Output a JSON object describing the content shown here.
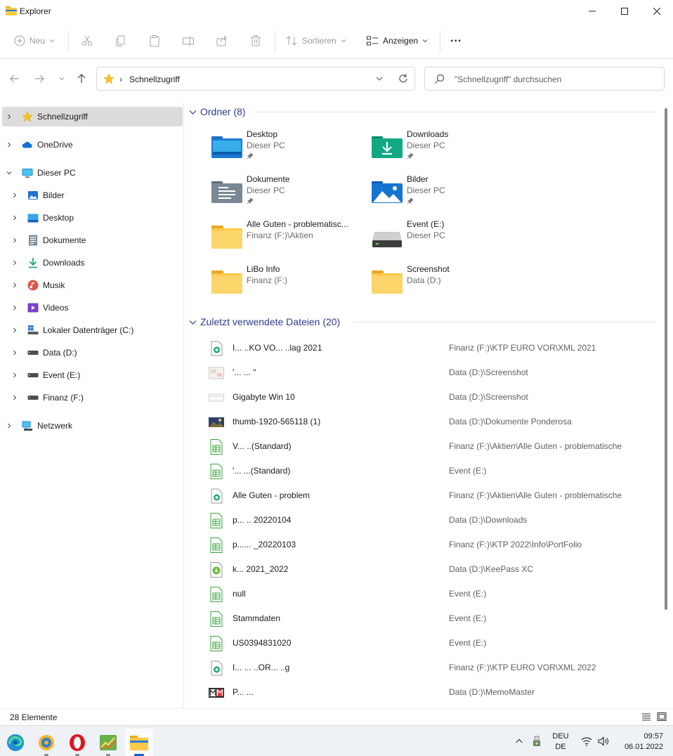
{
  "window": {
    "title": "Explorer"
  },
  "toolbar": {
    "new_label": "Neu",
    "sort_label": "Sortieren",
    "view_label": "Anzeigen",
    "more_label": "..."
  },
  "address": {
    "crumb": "Schnellzugriff"
  },
  "search": {
    "placeholder": "\"Schnellzugriff\" durchsuchen"
  },
  "sidebar": {
    "items": [
      {
        "label": "Schnellzugriff",
        "icon": "star-icon"
      },
      {
        "label": "OneDrive",
        "icon": "cloud-icon"
      },
      {
        "label": "Dieser PC",
        "icon": "monitor-icon"
      },
      {
        "label": "Bilder",
        "icon": "pictures-icon"
      },
      {
        "label": "Desktop",
        "icon": "desktop-icon"
      },
      {
        "label": "Dokumente",
        "icon": "documents-icon"
      },
      {
        "label": "Downloads",
        "icon": "download-icon"
      },
      {
        "label": "Musik",
        "icon": "music-icon"
      },
      {
        "label": "Videos",
        "icon": "videos-icon"
      },
      {
        "label": "Lokaler Datenträger (C:)",
        "icon": "windows-drive-icon"
      },
      {
        "label": "Data (D:)",
        "icon": "drive-icon"
      },
      {
        "label": "Event (E:)",
        "icon": "drive-icon"
      },
      {
        "label": "Finanz (F:)",
        "icon": "drive-icon"
      },
      {
        "label": "Netzwerk",
        "icon": "network-icon"
      }
    ]
  },
  "folders": {
    "heading": "Ordner (8)",
    "items": [
      {
        "name": "Desktop",
        "sub": "Dieser PC",
        "pinned": true,
        "icon": "desktop-folder-icon"
      },
      {
        "name": "Downloads",
        "sub": "Dieser PC",
        "pinned": true,
        "icon": "downloads-folder-icon"
      },
      {
        "name": "Dokumente",
        "sub": "Dieser PC",
        "pinned": true,
        "icon": "documents-folder-icon"
      },
      {
        "name": "Bilder",
        "sub": "Dieser PC",
        "pinned": true,
        "icon": "pictures-folder-icon"
      },
      {
        "name": "Alle Guten - problematisc...",
        "sub": "Finanz (F:)\\Aktien",
        "pinned": false,
        "icon": "folder-icon"
      },
      {
        "name": "Event (E:)",
        "sub": "Dieser PC",
        "pinned": false,
        "icon": "drive-icon"
      },
      {
        "name": "LiBo Info",
        "sub": "Finanz (F:)",
        "pinned": false,
        "icon": "folder-icon"
      },
      {
        "name": "Screenshot",
        "sub": "Data (D:)",
        "pinned": false,
        "icon": "folder-icon"
      }
    ]
  },
  "recent": {
    "heading": "Zuletzt verwendete Dateien (20)",
    "items": [
      {
        "name": "I... ..KO VO... ..lag 2021",
        "path": "Finanz (F:)\\KTP EURO VOR\\XML 2021",
        "icon": "xml-file-icon"
      },
      {
        "name": "'... ... ''",
        "path": "Data (D:)\\Screenshot",
        "icon": "image-thumb-icon"
      },
      {
        "name": "Gigabyte Win 10",
        "path": "Data (D:)\\Screenshot",
        "icon": "image-thumb-icon"
      },
      {
        "name": "thumb-1920-565118 (1)",
        "path": "Data (D:)\\Dokumente Ponderosa",
        "icon": "photo-thumb-icon"
      },
      {
        "name": "V... ..(Standard)",
        "path": "Finanz (F:)\\Aktien\\Alle Guten - problematische",
        "icon": "spreadsheet-icon"
      },
      {
        "name": "'... ...(Standard)",
        "path": "Event (E:)",
        "icon": "spreadsheet-icon"
      },
      {
        "name": "Alle Guten - problem",
        "path": "Finanz (F:)\\Aktien\\Alle Guten - problematische",
        "icon": "xml-file-icon"
      },
      {
        "name": "p... .. 20220104",
        "path": "Data (D:)\\Downloads",
        "icon": "spreadsheet-icon"
      },
      {
        "name": "p...... _20220103",
        "path": "Finanz (F:)\\KTP 2022\\Info\\PortFolio",
        "icon": "spreadsheet-icon"
      },
      {
        "name": "k... 2021_2022",
        "path": "Data (D:)\\KeePass XC",
        "icon": "keepass-icon"
      },
      {
        "name": "null",
        "path": "Event (E:)",
        "icon": "spreadsheet-icon"
      },
      {
        "name": "Stammdaten",
        "path": "Event (E:)",
        "icon": "spreadsheet-icon"
      },
      {
        "name": "US0394831020",
        "path": "Event (E:)",
        "icon": "spreadsheet-icon"
      },
      {
        "name": "I... ... ..OR... ..g",
        "path": "Finanz (F:)\\KTP EURO VOR\\XML 2022",
        "icon": "xml-file-icon"
      },
      {
        "name": "P... ...",
        "path": "Data (D:)\\MemoMaster",
        "icon": "memomaster-icon"
      }
    ]
  },
  "status": {
    "count": "28 Elemente"
  },
  "taskbar": {
    "apps": [
      {
        "name": "edge",
        "icon": "edge-icon"
      },
      {
        "name": "settings",
        "icon": "globe-gear-icon"
      },
      {
        "name": "opera",
        "icon": "opera-icon"
      },
      {
        "name": "stocks",
        "icon": "chart-icon"
      },
      {
        "name": "explorer",
        "icon": "folder-icon",
        "active": true
      }
    ],
    "lang_top": "DEU",
    "lang_bottom": "DE",
    "time": "09:57",
    "date": "06.01.2022"
  },
  "colors": {
    "accent": "#2e3c8c",
    "selection": "#dcdcdc",
    "folder": "#f9c947",
    "taskbar": "#eef1f6"
  }
}
